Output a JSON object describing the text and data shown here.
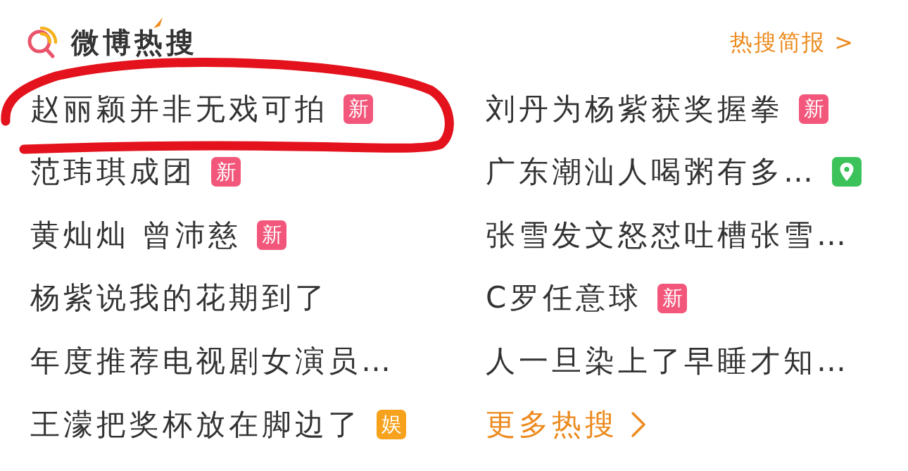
{
  "header": {
    "title": "微博热搜",
    "brief_link": "热搜简报 >"
  },
  "items": [
    {
      "text": "赵丽颖并非无戏可拍",
      "badge": {
        "kind": "new",
        "label": "新"
      },
      "circled": true
    },
    {
      "text": "刘丹为杨紫获奖握拳",
      "badge": {
        "kind": "new",
        "label": "新"
      },
      "circled": false
    },
    {
      "text": "范玮琪成团",
      "badge": {
        "kind": "new",
        "label": "新"
      },
      "circled": false
    },
    {
      "text": "广东潮汕人喝粥有多…",
      "badge": {
        "kind": "location"
      },
      "circled": false
    },
    {
      "text": "黄灿灿 曾沛慈",
      "badge": {
        "kind": "new",
        "label": "新"
      },
      "circled": false
    },
    {
      "text": "张雪发文怒怼吐槽张雪…",
      "circled": false
    },
    {
      "text": "杨紫说我的花期到了",
      "circled": false
    },
    {
      "text": "C罗任意球",
      "badge": {
        "kind": "new",
        "label": "新"
      },
      "circled": false
    },
    {
      "text": "年度推荐电视剧女演员…",
      "circled": false
    },
    {
      "text": "人一旦染上了早睡才知…",
      "circled": false
    },
    {
      "text": "王濛把奖杯放在脚边了",
      "badge": {
        "kind": "entertainment",
        "label": "娱"
      },
      "circled": false
    }
  ],
  "more_link": {
    "label": "更多热搜"
  }
}
